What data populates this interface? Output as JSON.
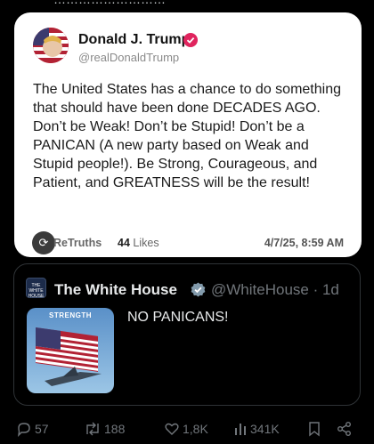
{
  "truth": {
    "author_name": "Donald J. Trump",
    "author_handle": "@realDonaldTrump",
    "body": "The United States has a chance to do something that should have been done DECADES AGO. Don’t be Weak! Don’t be Stupid! Don’t be a PANICAN (A new party based on Weak and Stupid people!). Be Strong, Courageous, and Patient, and GREATNESS will be the result!",
    "retruths_label": "ReTruths",
    "likes_count": "44",
    "likes_label": "Likes",
    "date": "4/7/25, 8:59 AM"
  },
  "quoted": {
    "author_name": "The White House",
    "author_handle": "@WhiteHouse · 1d",
    "media_caption": "STRENGTH",
    "avatar_text": "THE WHITE HOUSE",
    "text": "NO PANICANS!"
  },
  "actions": {
    "replies": "57",
    "reposts": "188",
    "likes": "1,8K",
    "views": "341K"
  },
  "colors": {
    "background": "#000000",
    "card": "#ffffff",
    "muted": "#71767b",
    "verified_truth": "#e0245e"
  }
}
